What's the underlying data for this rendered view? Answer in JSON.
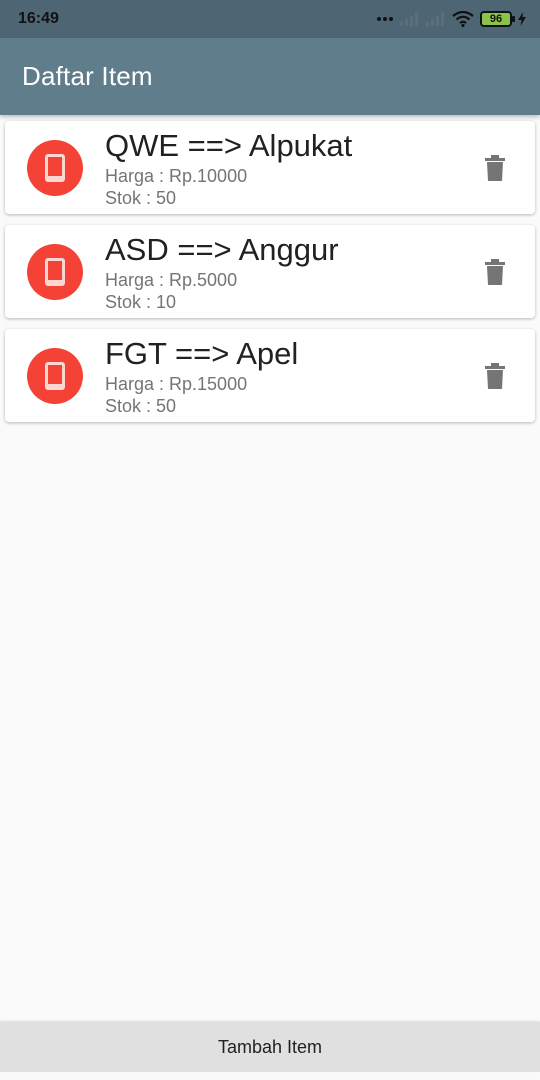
{
  "status_bar": {
    "time": "16:49",
    "battery_level": "96"
  },
  "app_bar": {
    "title": "Daftar Item"
  },
  "items": [
    {
      "title": "QWE ==> Alpukat",
      "price": "Harga : Rp.10000",
      "stock": "Stok : 50"
    },
    {
      "title": "ASD ==> Anggur",
      "price": "Harga : Rp.5000",
      "stock": "Stok : 10"
    },
    {
      "title": "FGT ==> Apel",
      "price": "Harga : Rp.15000",
      "stock": "Stok : 50"
    }
  ],
  "footer": {
    "add_button_label": "Tambah Item"
  },
  "icons": {
    "avatar": "phone-icon",
    "delete": "trash-icon"
  },
  "colors": {
    "status_bar": "#4e6673",
    "app_bar": "#607d8b",
    "avatar": "#f44336",
    "battery": "#8bc34a"
  }
}
